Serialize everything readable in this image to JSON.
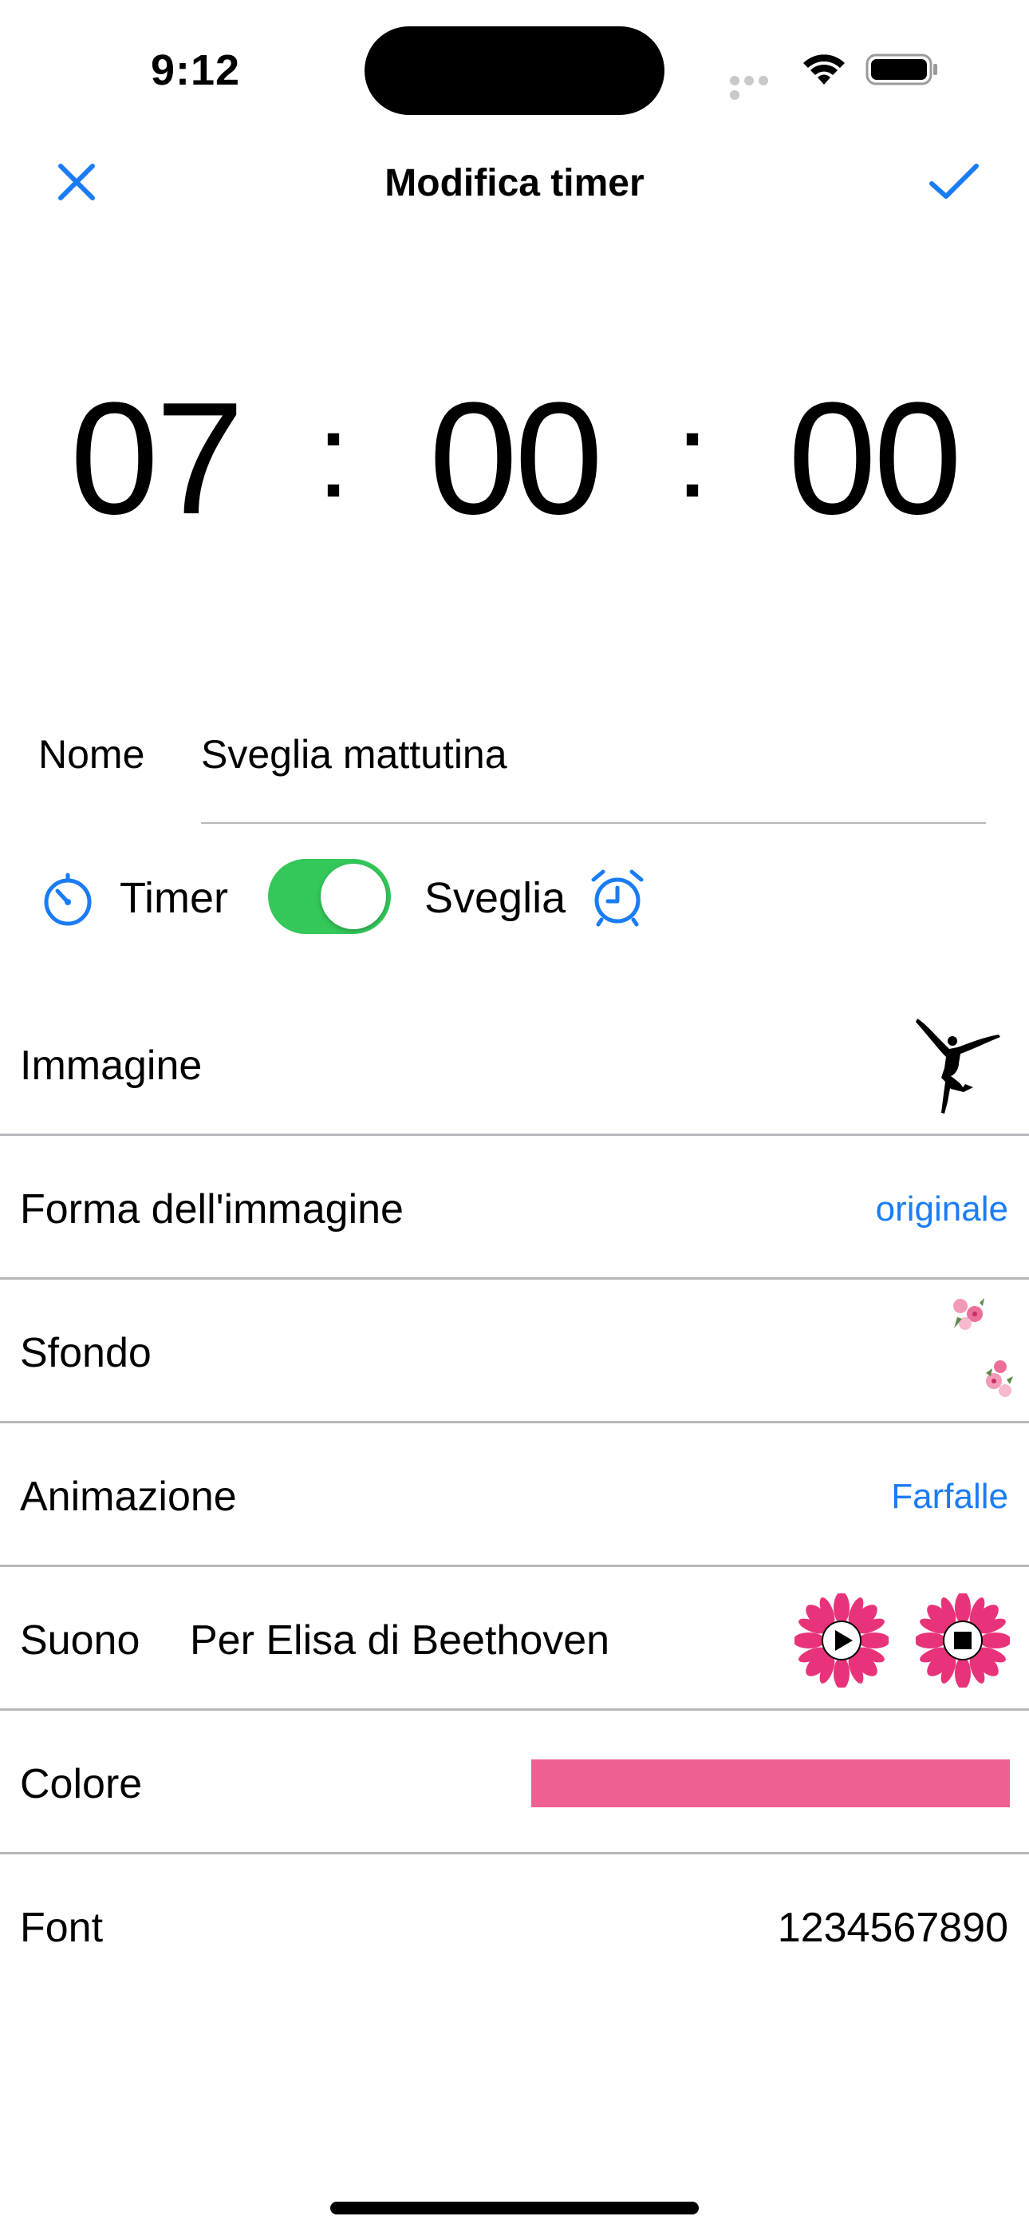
{
  "status_bar": {
    "time": "9:12"
  },
  "nav": {
    "title": "Modifica timer",
    "close_icon": "close-icon",
    "confirm_icon": "checkmark-icon",
    "accent_color": "#1a7cf5"
  },
  "time_picker": {
    "hours": "07",
    "minutes": "00",
    "seconds": "00",
    "separator": ":"
  },
  "name_field": {
    "label": "Nome",
    "value": "Sveglia mattutina"
  },
  "mode": {
    "timer_label": "Timer",
    "alarm_label": "Sveglia",
    "toggle_on": true,
    "toggle_color": "#34c759"
  },
  "settings": {
    "image": {
      "label": "Immagine",
      "preview_icon": "ballerina-silhouette-icon"
    },
    "image_shape": {
      "label": "Forma dell'immagine",
      "value": "originale"
    },
    "background": {
      "label": "Sfondo",
      "preview_icon": "floral-pattern-icon"
    },
    "animation": {
      "label": "Animazione",
      "value": "Farfalle"
    },
    "sound": {
      "label": "Suono",
      "value": "Per Elisa di Beethoven",
      "play_icon": "flower-play-icon",
      "stop_icon": "flower-stop-icon",
      "flower_color": "#e8337a"
    },
    "color": {
      "label": "Colore",
      "value_color": "#ef5f91"
    },
    "font": {
      "label": "Font",
      "sample": "1234567890"
    }
  }
}
